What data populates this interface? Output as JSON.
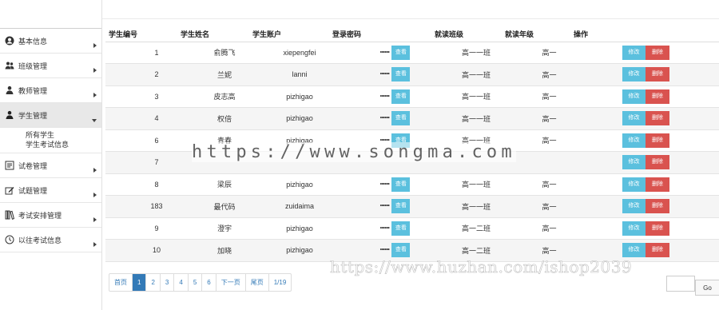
{
  "sidebar": {
    "items": [
      {
        "label": "基本信息",
        "icon": "user-circle-icon"
      },
      {
        "label": "班级管理",
        "icon": "group-icon"
      },
      {
        "label": "教师管理",
        "icon": "teacher-icon"
      },
      {
        "label": "学生管理",
        "icon": "student-icon",
        "active": true
      },
      {
        "label": "试卷管理",
        "icon": "document-icon"
      },
      {
        "label": "试题管理",
        "icon": "edit-icon"
      },
      {
        "label": "考试安排管理",
        "icon": "books-icon"
      },
      {
        "label": "以往考试信息",
        "icon": "clock-icon"
      }
    ],
    "submenu": [
      "所有学生",
      "学生考试信息"
    ]
  },
  "table": {
    "headers": [
      "学生编号",
      "学生姓名",
      "学生账户",
      "登录密码",
      "就读班级",
      "就读年级",
      "操作"
    ],
    "rows": [
      {
        "id": "1",
        "name": "俞腾飞",
        "account": "xiepengfei",
        "password": "••••••",
        "class": "高一一班",
        "grade": "高一"
      },
      {
        "id": "2",
        "name": "兰妮",
        "account": "lanni",
        "password": "••••••",
        "class": "高一一班",
        "grade": "高一"
      },
      {
        "id": "3",
        "name": "皮志高",
        "account": "pizhigao",
        "password": "••••••",
        "class": "高一一班",
        "grade": "高一"
      },
      {
        "id": "4",
        "name": "权倍",
        "account": "pizhigao",
        "password": "••••••",
        "class": "高一一班",
        "grade": "高一"
      },
      {
        "id": "6",
        "name": "青春",
        "account": "pizhigao",
        "password": "••••••",
        "class": "高一一班",
        "grade": "高一"
      },
      {
        "id": "7",
        "name": "",
        "account": "",
        "password": "",
        "class": "",
        "grade": ""
      },
      {
        "id": "8",
        "name": "梁辰",
        "account": "pizhigao",
        "password": "••••••",
        "class": "高一一班",
        "grade": "高一"
      },
      {
        "id": "183",
        "name": "最代码",
        "account": "zuidaima",
        "password": "••••••",
        "class": "高一一班",
        "grade": "高一"
      },
      {
        "id": "9",
        "name": "澄宇",
        "account": "pizhigao",
        "password": "••••••",
        "class": "高一二班",
        "grade": "高一"
      },
      {
        "id": "10",
        "name": "加晓",
        "account": "pizhigao",
        "password": "••••••",
        "class": "高一二班",
        "grade": "高一"
      }
    ],
    "view_label": "查看",
    "edit_label": "修改",
    "delete_label": "删除"
  },
  "pagination": {
    "first": "首页",
    "pages": [
      "1",
      "2",
      "3",
      "4",
      "5",
      "6"
    ],
    "current": "1",
    "next": "下一页",
    "last": "尾页",
    "info": "1/19",
    "go": "Go"
  },
  "watermarks": {
    "primary": "https://www.songma.com",
    "secondary": "https://www.huzhan.com/ishop2039"
  },
  "colors": {
    "view_button": "#5bc0de",
    "edit_button": "#5bc0de",
    "delete_button": "#d9534f",
    "active_page": "#337ab7"
  }
}
